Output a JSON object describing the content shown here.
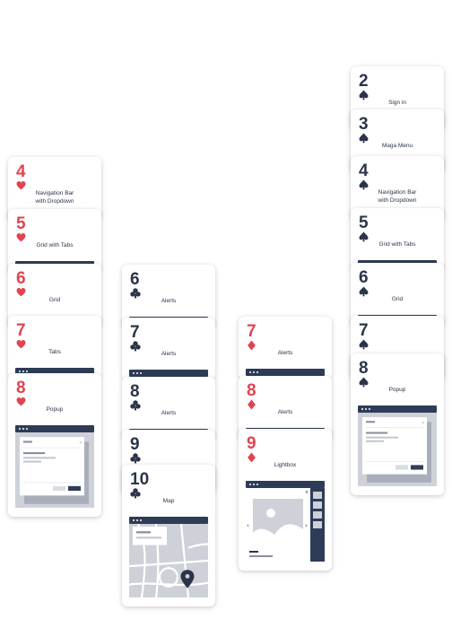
{
  "colors": {
    "red": "#e0444f",
    "navy": "#2b3448",
    "window_bar": "#2e3c57",
    "preview_bg": "#ced1d8"
  },
  "columns": [
    {
      "id": "hearts",
      "cards": [
        {
          "rank": "4",
          "suit": "heart",
          "label_lines": [
            "Navigation Bar",
            "with Dropdown"
          ]
        },
        {
          "rank": "5",
          "suit": "heart",
          "label_lines": [
            "Grid with Tabs"
          ]
        },
        {
          "rank": "6",
          "suit": "heart",
          "label_lines": [
            "Grid"
          ]
        },
        {
          "rank": "7",
          "suit": "heart",
          "label_lines": [
            "Tabs"
          ]
        },
        {
          "rank": "8",
          "suit": "heart",
          "label_lines": [
            "Popup"
          ],
          "preview": "popup"
        }
      ]
    },
    {
      "id": "clubs",
      "cards": [
        {
          "rank": "6",
          "suit": "club",
          "label_lines": [
            "Alerts"
          ]
        },
        {
          "rank": "7",
          "suit": "club",
          "label_lines": [
            "Alerts"
          ]
        },
        {
          "rank": "8",
          "suit": "club",
          "label_lines": [
            "Alerts"
          ]
        },
        {
          "rank": "9",
          "suit": "club",
          "label_lines": []
        },
        {
          "rank": "10",
          "suit": "club",
          "label_lines": [
            "Map"
          ],
          "preview": "map"
        }
      ]
    },
    {
      "id": "diamonds",
      "cards": [
        {
          "rank": "7",
          "suit": "diamond",
          "label_lines": [
            "Alerts"
          ]
        },
        {
          "rank": "8",
          "suit": "diamond",
          "label_lines": [
            "Alerts"
          ]
        },
        {
          "rank": "9",
          "suit": "diamond",
          "label_lines": [
            "Lightbox"
          ],
          "preview": "lightbox"
        }
      ]
    },
    {
      "id": "spades",
      "cards": [
        {
          "rank": "2",
          "suit": "spade",
          "label_lines": [
            "Sign in"
          ]
        },
        {
          "rank": "3",
          "suit": "spade",
          "label_lines": [
            "Maga Menu"
          ]
        },
        {
          "rank": "4",
          "suit": "spade",
          "label_lines": [
            "Navigation Bar",
            "with Dropdown"
          ]
        },
        {
          "rank": "5",
          "suit": "spade",
          "label_lines": [
            "Grid with Tabs"
          ]
        },
        {
          "rank": "6",
          "suit": "spade",
          "label_lines": [
            "Grid"
          ]
        },
        {
          "rank": "7",
          "suit": "spade",
          "label_lines": []
        },
        {
          "rank": "8",
          "suit": "spade",
          "label_lines": [
            "Popup"
          ],
          "preview": "popup"
        }
      ]
    }
  ]
}
